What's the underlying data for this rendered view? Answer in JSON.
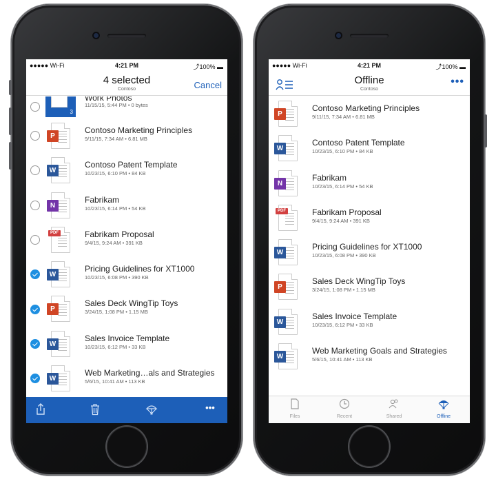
{
  "left_phone": {
    "status": {
      "carrier": "●●●●● Wi-Fi ",
      "time": "4:21 PM",
      "battery": "⤴100% ▬"
    },
    "header": {
      "title": "4 selected",
      "subtitle": "Contoso",
      "cancel_label": "Cancel"
    },
    "folder_row": {
      "name": "Work Photos",
      "meta": "11/15/15, 5:44 PM • 0 bytes",
      "count": "3"
    },
    "rows": [
      {
        "name": "Contoso Marketing Principles",
        "meta": "9/11/15, 7:34 AM • 6.81 MB",
        "icon": "P",
        "checked": false
      },
      {
        "name": "Contoso Patent Template",
        "meta": "10/23/15, 6:10 PM • 84 KB",
        "icon": "W",
        "checked": false
      },
      {
        "name": "Fabrikam",
        "meta": "10/23/15, 6:14 PM • 54 KB",
        "icon": "N",
        "checked": false
      },
      {
        "name": "Fabrikam Proposal",
        "meta": "9/4/15, 9:24 AM • 391 KB",
        "icon": "PDF",
        "checked": false
      },
      {
        "name": "Pricing Guidelines for XT1000",
        "meta": "10/23/15, 6:08 PM • 390 KB",
        "icon": "W",
        "checked": true
      },
      {
        "name": "Sales Deck WingTip Toys",
        "meta": "3/24/15, 1:08 PM • 1.15 MB",
        "icon": "P",
        "checked": true
      },
      {
        "name": "Sales Invoice Template",
        "meta": "10/23/15, 6:12 PM • 33 KB",
        "icon": "W",
        "checked": true
      },
      {
        "name": "Web Marketing…als and Strategies",
        "meta": "5/6/15, 10:41 AM • 113 KB",
        "icon": "W",
        "checked": true
      }
    ],
    "toolbar": {
      "share_icon": "share-icon",
      "delete_icon": "trash-icon",
      "offline_icon": "parachute-icon",
      "more_label": "•••"
    }
  },
  "right_phone": {
    "status": {
      "carrier": "●●●●● Wi-Fi ",
      "time": "4:21 PM",
      "battery": "⤴100% ▬"
    },
    "header": {
      "title": "Offline",
      "subtitle": "Contoso",
      "more_label": "•••"
    },
    "rows": [
      {
        "name": "Contoso Marketing Principles",
        "meta": "9/11/15, 7:34 AM • 6.81 MB",
        "icon": "P"
      },
      {
        "name": "Contoso Patent Template",
        "meta": "10/23/15, 6:10 PM • 84 KB",
        "icon": "W"
      },
      {
        "name": "Fabrikam",
        "meta": "10/23/15, 6:14 PM • 54 KB",
        "icon": "N"
      },
      {
        "name": "Fabrikam Proposal",
        "meta": "9/4/15, 9:24 AM • 391 KB",
        "icon": "PDF"
      },
      {
        "name": "Pricing Guidelines for XT1000",
        "meta": "10/23/15, 6:08 PM • 390 KB",
        "icon": "W"
      },
      {
        "name": "Sales Deck WingTip Toys",
        "meta": "3/24/15, 1:08 PM • 1.15 MB",
        "icon": "P"
      },
      {
        "name": "Sales Invoice Template",
        "meta": "10/23/15, 6:12 PM • 33 KB",
        "icon": "W"
      },
      {
        "name": "Web Marketing Goals and Strategies",
        "meta": "5/6/15, 10:41 AM • 113 KB",
        "icon": "W"
      }
    ],
    "tabs": [
      {
        "label": "Files",
        "icon": "file-icon",
        "active": false
      },
      {
        "label": "Recent",
        "icon": "clock-icon",
        "active": false
      },
      {
        "label": "Shared",
        "icon": "people-icon",
        "active": false
      },
      {
        "label": "Offline",
        "icon": "parachute-icon",
        "active": true
      }
    ]
  },
  "colors": {
    "accent": "#1d5fb8",
    "check": "#1e8fe1",
    "word": "#2b579a",
    "powerpoint": "#d04525",
    "onenote": "#7334a8",
    "pdf": "#d24040"
  }
}
